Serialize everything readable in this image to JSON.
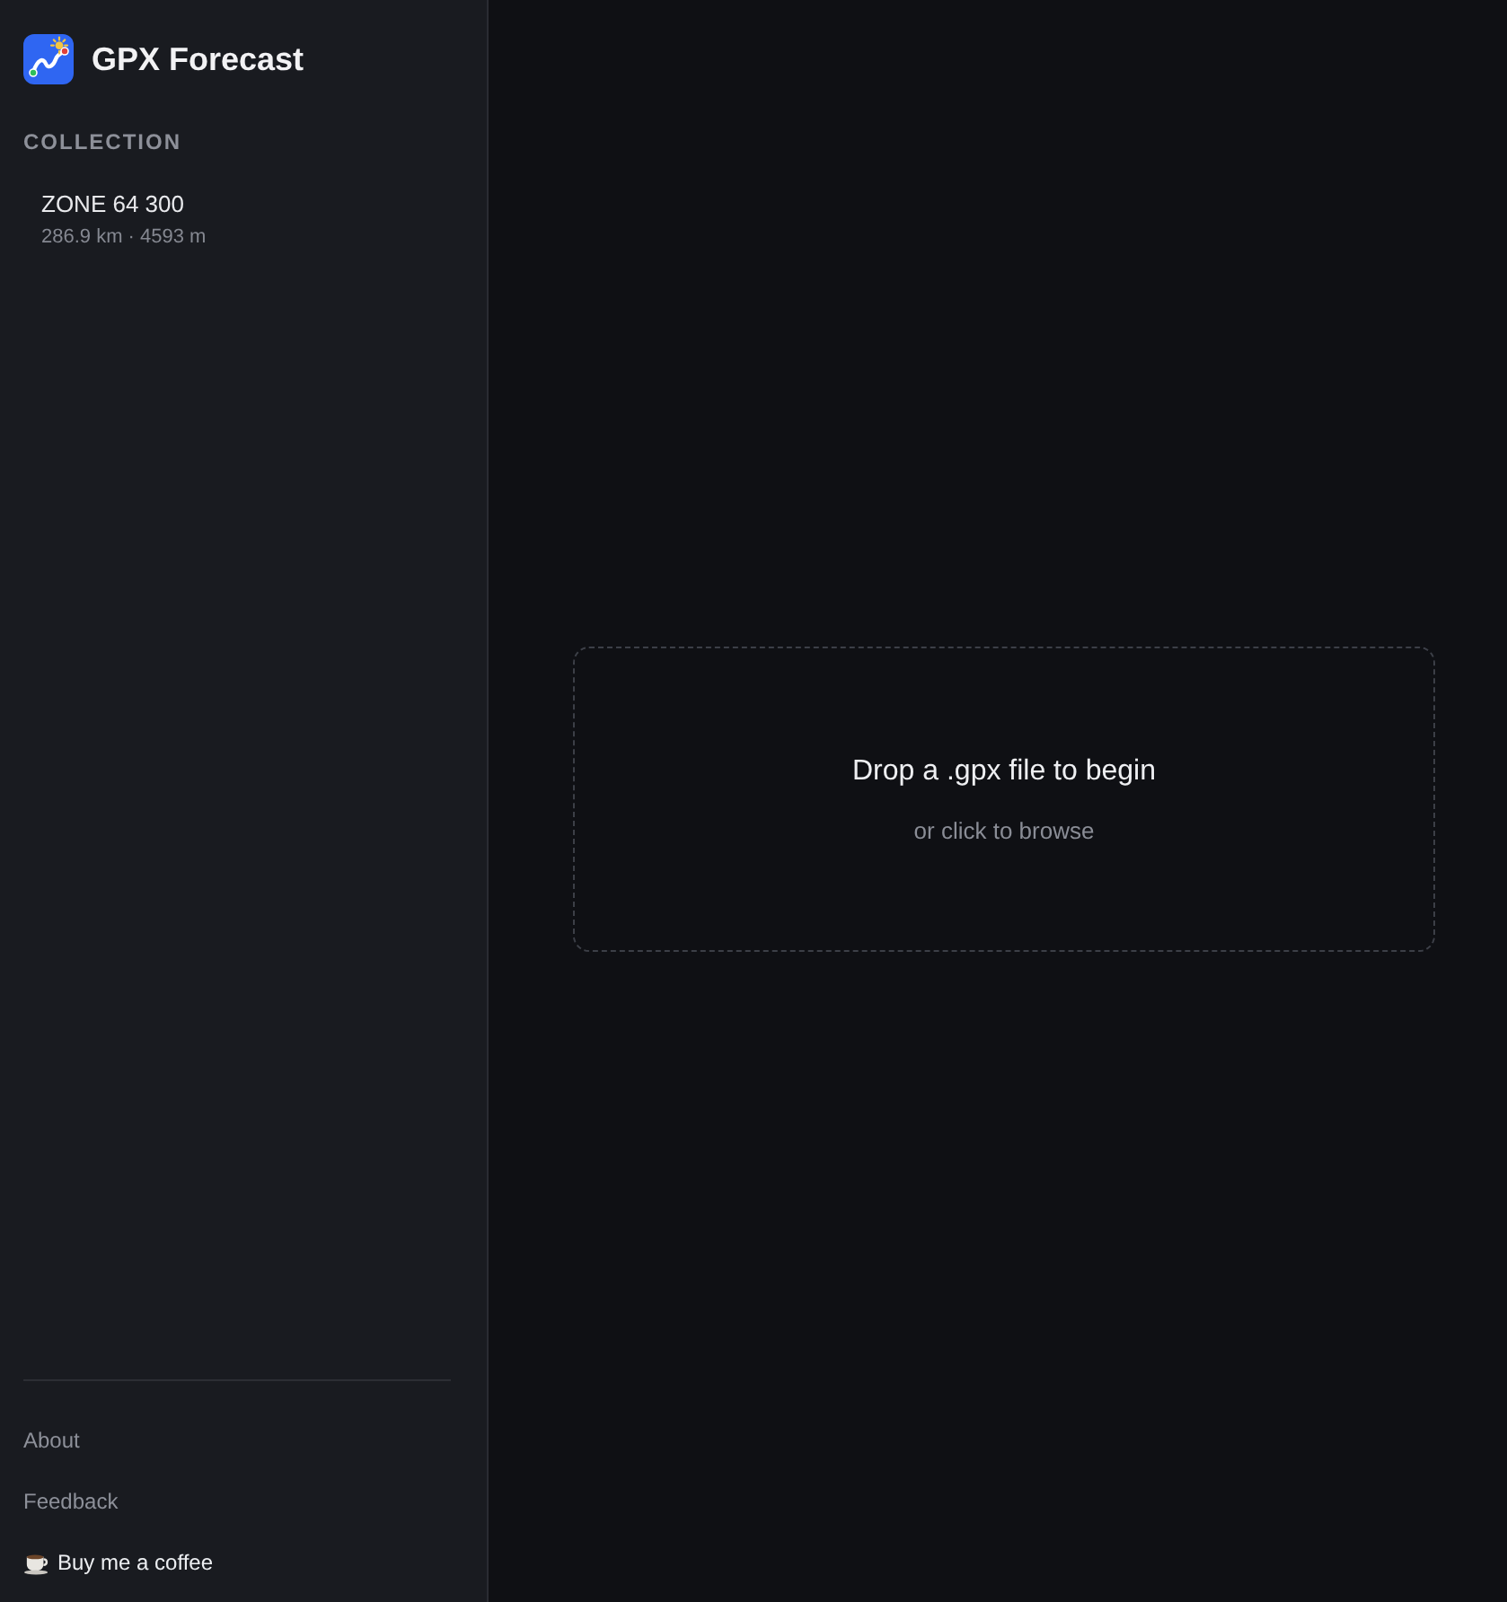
{
  "app": {
    "title": "GPX Forecast"
  },
  "sidebar": {
    "section_title": "COLLECTION",
    "items": [
      {
        "name": "ZONE 64 300",
        "meta": "286.9 km · 4593 m",
        "selected": false
      }
    ],
    "footer_links": [
      {
        "kind": "link",
        "label": "About"
      },
      {
        "kind": "link",
        "label": "Feedback"
      },
      {
        "kind": "coffee",
        "label": "Buy me a coffee"
      }
    ]
  },
  "dropzone": {
    "title": "Drop a .gpx file to begin",
    "hint": "or click to browse"
  }
}
